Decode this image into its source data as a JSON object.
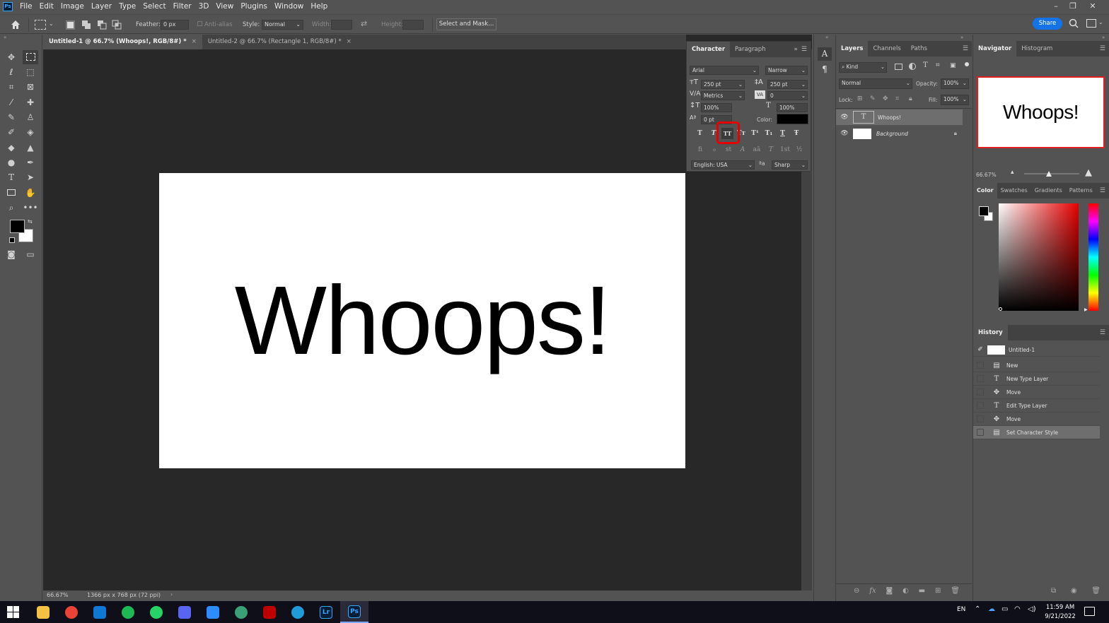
{
  "app": {
    "logo_text": "Ps"
  },
  "menu": [
    "File",
    "Edit",
    "Image",
    "Layer",
    "Type",
    "Select",
    "Filter",
    "3D",
    "View",
    "Plugins",
    "Window",
    "Help"
  ],
  "options": {
    "feather_label": "Feather:",
    "feather_value": "0 px",
    "antialias_label": "Anti-alias",
    "style_label": "Style:",
    "style_value": "Normal",
    "width_label": "Width:",
    "height_label": "Height:",
    "select_mask_label": "Select and Mask...",
    "share_label": "Share"
  },
  "tabs": [
    {
      "label": "Untitled-1 @ 66.7% (Whoops!, RGB/8#) *"
    },
    {
      "label": "Untitled-2 @ 66.7% (Rectangle 1, RGB/8#) *"
    }
  ],
  "canvas": {
    "text": "Whoops!"
  },
  "status": {
    "zoom": "66.67%",
    "doc_info": "1366 px x 768 px (72 ppi)"
  },
  "character": {
    "tab_character": "Character",
    "tab_paragraph": "Paragraph",
    "font_family": "Arial",
    "font_style": "Narrow",
    "font_size": "250 pt",
    "leading": "250 pt",
    "kerning": "Metrics",
    "tracking": "0",
    "vertical_scale": "100%",
    "horizontal_scale": "100%",
    "baseline_shift": "0 pt",
    "color_label": "Color:",
    "language": "English: USA",
    "antialias": "Sharp",
    "aa_glyph": "ªa",
    "style_buttons": [
      "T",
      "T",
      "TT",
      "Tт",
      "T¹",
      "T₁",
      "T",
      "Ŧ"
    ],
    "ot_buttons": [
      "ﬁ",
      "ℴ",
      "st",
      "A",
      "aā",
      "T",
      "1st",
      "½"
    ]
  },
  "layers": {
    "tab_layers": "Layers",
    "tab_channels": "Channels",
    "tab_paths": "Paths",
    "kind_label": "Kind",
    "blend_mode": "Normal",
    "opacity_label": "Opacity:",
    "opacity_value": "100%",
    "lock_label": "Lock:",
    "fill_label": "Fill:",
    "fill_value": "100%",
    "items": [
      {
        "name": "Whoops!",
        "type": "text",
        "selected": true
      },
      {
        "name": "Background",
        "type": "image",
        "selected": false
      }
    ]
  },
  "navigator": {
    "tab_navigator": "Navigator",
    "tab_histogram": "Histogram",
    "preview_text": "Whoops!",
    "zoom": "66.67%"
  },
  "color_panel": {
    "tabs": [
      "Color",
      "Swatches",
      "Gradients",
      "Patterns"
    ],
    "hue_color": "#e60000"
  },
  "history": {
    "title": "History",
    "snapshot": "Untitled-1",
    "items": [
      {
        "label": "New",
        "icon": "doc-icon"
      },
      {
        "label": "New Type Layer",
        "icon": "type-icon"
      },
      {
        "label": "Move",
        "icon": "move-icon"
      },
      {
        "label": "Edit Type Layer",
        "icon": "type-icon"
      },
      {
        "label": "Move",
        "icon": "move-icon"
      },
      {
        "label": "Set Character Style",
        "icon": "doc-icon"
      }
    ]
  },
  "taskbar": {
    "lang": "EN",
    "time": "11:59 AM",
    "date": "9/21/2022",
    "icons": [
      {
        "name": "file-explorer-icon",
        "glyph": "",
        "color": "#f4c242"
      },
      {
        "name": "chrome-icon",
        "glyph": "",
        "color": "#ea4335"
      },
      {
        "name": "outlook-icon",
        "glyph": "",
        "color": "#0f78d4"
      },
      {
        "name": "spotify-icon",
        "glyph": "",
        "color": "#1db954"
      },
      {
        "name": "whatsapp-icon",
        "glyph": "",
        "color": "#25d366"
      },
      {
        "name": "discord-icon",
        "glyph": "",
        "color": "#5865f2"
      },
      {
        "name": "zoom-icon",
        "glyph": "",
        "color": "#2d8cff"
      },
      {
        "name": "globe-icon",
        "glyph": "",
        "color": "#3aa076"
      },
      {
        "name": "filezilla-icon",
        "glyph": "",
        "color": "#bf0000"
      },
      {
        "name": "edge-icon",
        "glyph": "",
        "color": "#1f9cd8"
      },
      {
        "name": "lightroom-icon",
        "glyph": "Lr",
        "color": "#001e36"
      },
      {
        "name": "photoshop-icon",
        "glyph": "Ps",
        "color": "#001e36"
      }
    ]
  }
}
